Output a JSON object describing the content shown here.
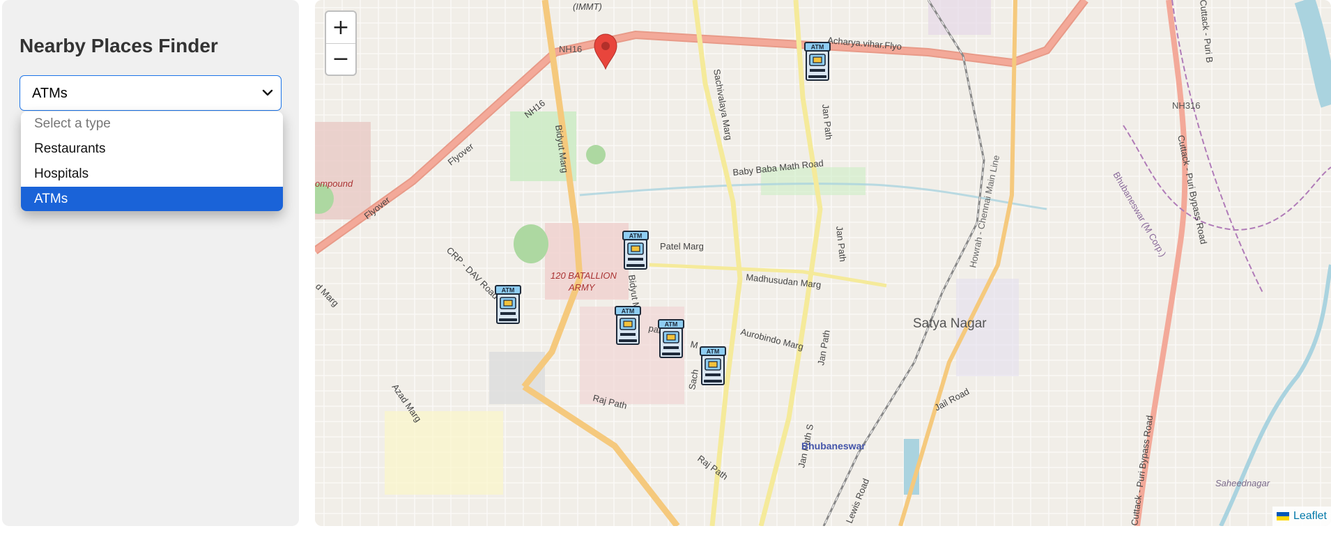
{
  "sidebar": {
    "title": "Nearby Places Finder",
    "select": {
      "selected_value": "ATMs",
      "options": [
        "Select a type",
        "Restaurants",
        "Hospitals",
        "ATMs"
      ]
    }
  },
  "map": {
    "zoom_in_label": "+",
    "zoom_out_label": "−",
    "attribution": "Leaflet",
    "labels": {
      "immt": "(IMMT)",
      "nh16_a": "NH16",
      "nh16_b": "NH16",
      "acharya": "Acharya.vihar.Flyo",
      "flyover_a": "Flyover",
      "flyover_b": "Flyover",
      "compound": "ompound",
      "crp": "CRP - DAV Road",
      "d_marg": "d Marg",
      "bidyut_a": "Bidyut Marg",
      "bidyut_b": "Bidyut M",
      "sachivalaya": "Sachivalaya Marg",
      "sachi2": "Sach",
      "janpath_a": "Jan Path",
      "janpath_b": "Jan Path",
      "janpath_c": "Jan Path",
      "janpath_d": "Jan Path S",
      "baby_baba": "Baby Baba Math Road",
      "patel": "Patel Marg",
      "battalion_1": "120 BATALLION",
      "battalion_2": "ARMY",
      "madhusudan": "Madhusudan Marg",
      "aurobindo": "Aurobindo Marg",
      "satya_nagar": "Satya Nagar",
      "howrah": "Howrah - Chennai Main Line",
      "nh316": "NH316",
      "cuttack_puri": "Cuttack - Puri Bypass Road",
      "cuttack_puri_2": "Cuttack - Puri Bypass Road",
      "cuttack_puri_3": "Cuttack - Puri B",
      "bbsr_corp": "Bhubaneswar (M Corp.)",
      "azad": "Azad Marg",
      "raj_path_a": "Raj Path",
      "raj_path_b": "Raj Path",
      "jail_road": "Jail Road",
      "bhubaneswar": "Bhubaneswar",
      "lewis": "Lewis Road",
      "saheednagar": "Saheednagar",
      "pab": "pab",
      "m_letter": "M"
    },
    "markers": {
      "location_pin": "location-pin-icon",
      "atm_label": "ATM",
      "atm_count": 6
    }
  },
  "colors": {
    "accent": "#1a63d8",
    "pin": "#e8453c",
    "atm_frame": "#1e2a3a",
    "atm_blue": "#8ecdf2",
    "atm_screen": "#f3c23c"
  }
}
